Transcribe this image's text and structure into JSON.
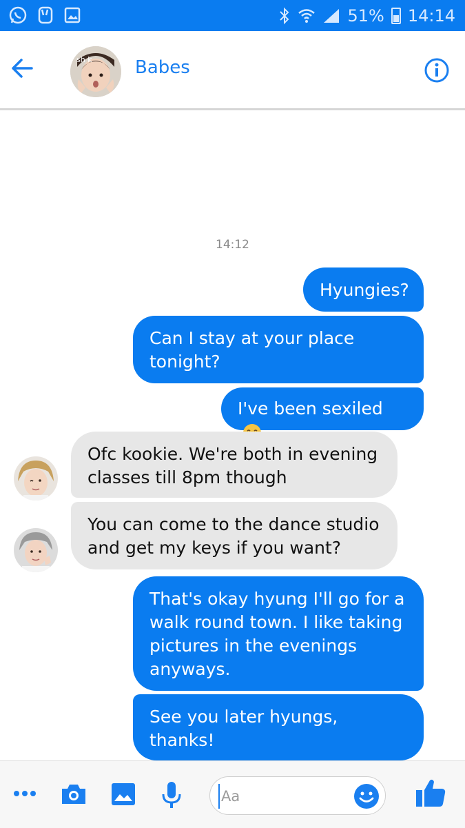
{
  "status_bar": {
    "battery": "51%",
    "time": "14:14",
    "left_icons": [
      "whatsapp-icon",
      "peace-hand-icon",
      "gallery-icon"
    ],
    "right_icons": [
      "bluetooth-icon",
      "wifi-icon",
      "signal-icon",
      "battery-icon"
    ]
  },
  "header": {
    "title": "Babes",
    "avatar_text": "sh    k",
    "icons": [
      "back-arrow-icon",
      "info-icon"
    ]
  },
  "conversation": {
    "timestamp": "14:12",
    "messages": [
      {
        "direction": "outgoing",
        "text": "Hyungies?"
      },
      {
        "direction": "outgoing",
        "text": "Can I stay at your place tonight?"
      },
      {
        "direction": "outgoing",
        "text": "I've been sexiled",
        "emoji": "crying-face-emoji"
      },
      {
        "direction": "incoming",
        "text": "Ofc kookie. We're both in evening classes till 8pm though"
      },
      {
        "direction": "incoming",
        "text": "You can come to the dance studio and get my keys if you want?"
      },
      {
        "direction": "outgoing",
        "text": "That's okay hyung I'll go for a walk round town. I like taking pictures in the evenings anyways."
      },
      {
        "direction": "outgoing",
        "text": "See you later hyungs, thanks!"
      }
    ]
  },
  "composer": {
    "placeholder": "Aa",
    "icons": [
      "more-icon",
      "camera-icon",
      "gallery-icon",
      "microphone-icon",
      "emoji-icon",
      "like-icon"
    ]
  },
  "colors": {
    "accent": "#0a7cf0",
    "incoming_bubble": "#e7e7e7"
  }
}
